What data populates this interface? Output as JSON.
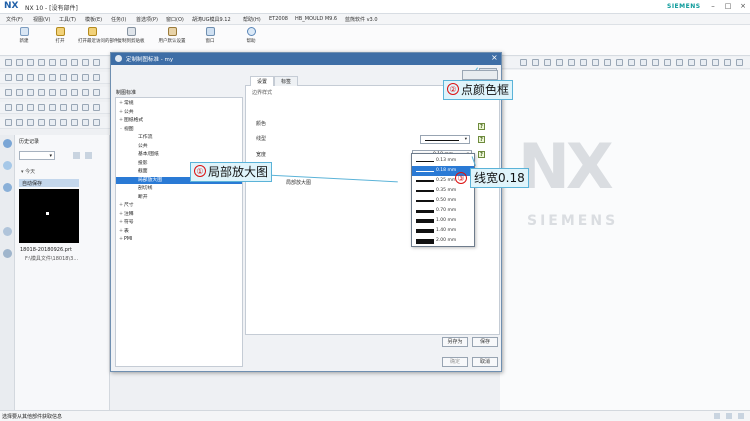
{
  "window": {
    "app_title": "NX 10 - [没有部件]",
    "brand": "SIEMENS",
    "logo": "NX"
  },
  "menu": [
    "文件(F)",
    "视图(V)",
    "工具(T)",
    "模板(E)",
    "任务(I)",
    "首选项(P)",
    "窗口(O)",
    "胡涛UG模具9.12",
    "帮助(H)",
    "ET2008",
    "HB_MOULD M9.6",
    "蓝熊软件 v3.0"
  ],
  "ribbon": [
    "新建",
    "打开",
    "打开最近访问的部件",
    "复制到剪贴板",
    "用户默认设置",
    "窗口",
    "帮助"
  ],
  "history": {
    "title": "历史记录",
    "today": "今天",
    "recent_label": "自动保存",
    "file_name": "18018-20180926.prt",
    "file_sub": "F:\\模具文件\\18018\\3...",
    "status_text": "选择要从其他部件获取信息"
  },
  "dialog": {
    "title": "定制制图标准 - my",
    "tree_header": "制图标准",
    "tree": [
      {
        "label": "常规",
        "level": 0,
        "pm": "+"
      },
      {
        "label": "公共",
        "level": 0,
        "pm": "+"
      },
      {
        "label": "图纸格式",
        "level": 0,
        "pm": "+"
      },
      {
        "label": "视图",
        "level": 0,
        "pm": "-"
      },
      {
        "label": "工作流",
        "level": 1,
        "pm": ""
      },
      {
        "label": "公共",
        "level": 1,
        "pm": ""
      },
      {
        "label": "基本/图纸",
        "level": 1,
        "pm": ""
      },
      {
        "label": "投影",
        "level": 1,
        "pm": ""
      },
      {
        "label": "截面",
        "level": 1,
        "pm": ""
      },
      {
        "label": "局部放大图",
        "level": 1,
        "pm": ""
      },
      {
        "label": "剖切线",
        "level": 1,
        "pm": ""
      },
      {
        "label": "断开",
        "level": 1,
        "pm": ""
      },
      {
        "label": "尺寸",
        "level": 0,
        "pm": "+"
      },
      {
        "label": "注释",
        "level": 0,
        "pm": "+"
      },
      {
        "label": "符号",
        "level": 0,
        "pm": "+"
      },
      {
        "label": "表",
        "level": 0,
        "pm": "+"
      },
      {
        "label": "PMI",
        "level": 0,
        "pm": "+"
      }
    ],
    "tabs": [
      "设置",
      "标签"
    ],
    "section_title": "边界样式",
    "color_label": "颜色",
    "linetype_label": "线型",
    "width_label": "宽度",
    "width_value": "0.18 mm",
    "partial_text": "局部放大图",
    "widths": [
      "0.13 mm",
      "0.18 mm",
      "0.25 mm",
      "0.35 mm",
      "0.50 mm",
      "0.70 mm",
      "1.00 mm",
      "1.40 mm",
      "2.00 mm"
    ],
    "selected_width": 1,
    "save_as": "另存为",
    "save": "保存",
    "confirm": "确定",
    "cancel": "取消"
  },
  "callouts": [
    {
      "num": "①",
      "text": "局部放大图"
    },
    {
      "num": "②",
      "text": "点颜色框"
    },
    {
      "num": "③",
      "text": "线宽0.18"
    }
  ],
  "colors": {
    "border_color": "#C20B0B",
    "accent": "#2A7AD5",
    "title_bar": "#3E6EA6"
  }
}
